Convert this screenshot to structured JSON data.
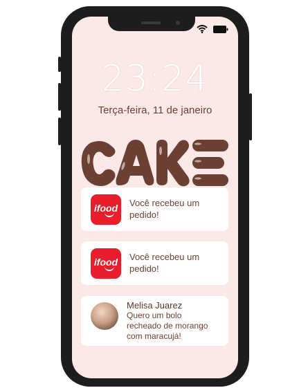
{
  "lockscreen": {
    "time": "23:24",
    "date": "Terça-feira, 11 de janeiro",
    "logo_text": "CAKE"
  },
  "notifications": [
    {
      "app": "ifood",
      "text_line1": "Você recebeu um",
      "text_line2": "pedido!"
    },
    {
      "app": "ifood",
      "text_line1": "Você recebeu um",
      "text_line2": "pedido!"
    },
    {
      "sender": "Melisa Juarez",
      "message_line1": "Quero um bolo",
      "message_line2": "recheado de morango",
      "message_line3": "com maracujá!"
    }
  ],
  "colors": {
    "background": "#fbe9e7",
    "brand_brown": "#6b3f31",
    "ifood_red": "#ea1d2c"
  },
  "icons": [
    "wifi-icon",
    "battery-icon",
    "ifood-logo-icon",
    "avatar"
  ]
}
